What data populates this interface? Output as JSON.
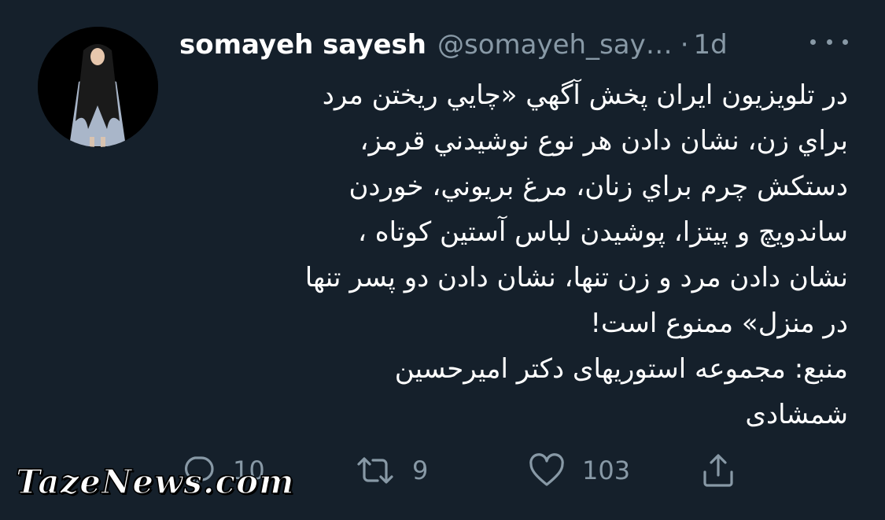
{
  "tweet": {
    "author": {
      "display_name": "somayeh sayesh",
      "handle": "@somayeh_say…",
      "separator": "·",
      "time": "1d"
    },
    "text_lines": [
      "در تلویزیون ایران پخش آگهي «چايي ريختن مرد",
      "براي زن، نشان دادن هر نوع نوشيدني قرمز،",
      "دستکش چرم براي زنان، مرغ بريوني، خوردن",
      "ساندويچ و پيتزا، پوشيدن لباس آستين کوتاه ،",
      "نشان دادن مرد و زن تنها، نشان دادن دو پسر تنها",
      "در منزل» ممنوع است!",
      "منبع: مجموعه استوريهای دکتر اميرحسين",
      "شمشادی"
    ],
    "actions": {
      "reply": {
        "icon": "reply-icon",
        "count": "10"
      },
      "retweet": {
        "icon": "retweet-icon",
        "count": "9"
      },
      "like": {
        "icon": "heart-icon",
        "count": "103"
      },
      "share": {
        "icon": "share-icon"
      }
    }
  },
  "watermark": "TazeNews.com",
  "colors": {
    "background": "#15202b",
    "text": "#ffffff",
    "muted": "#8899a6"
  }
}
